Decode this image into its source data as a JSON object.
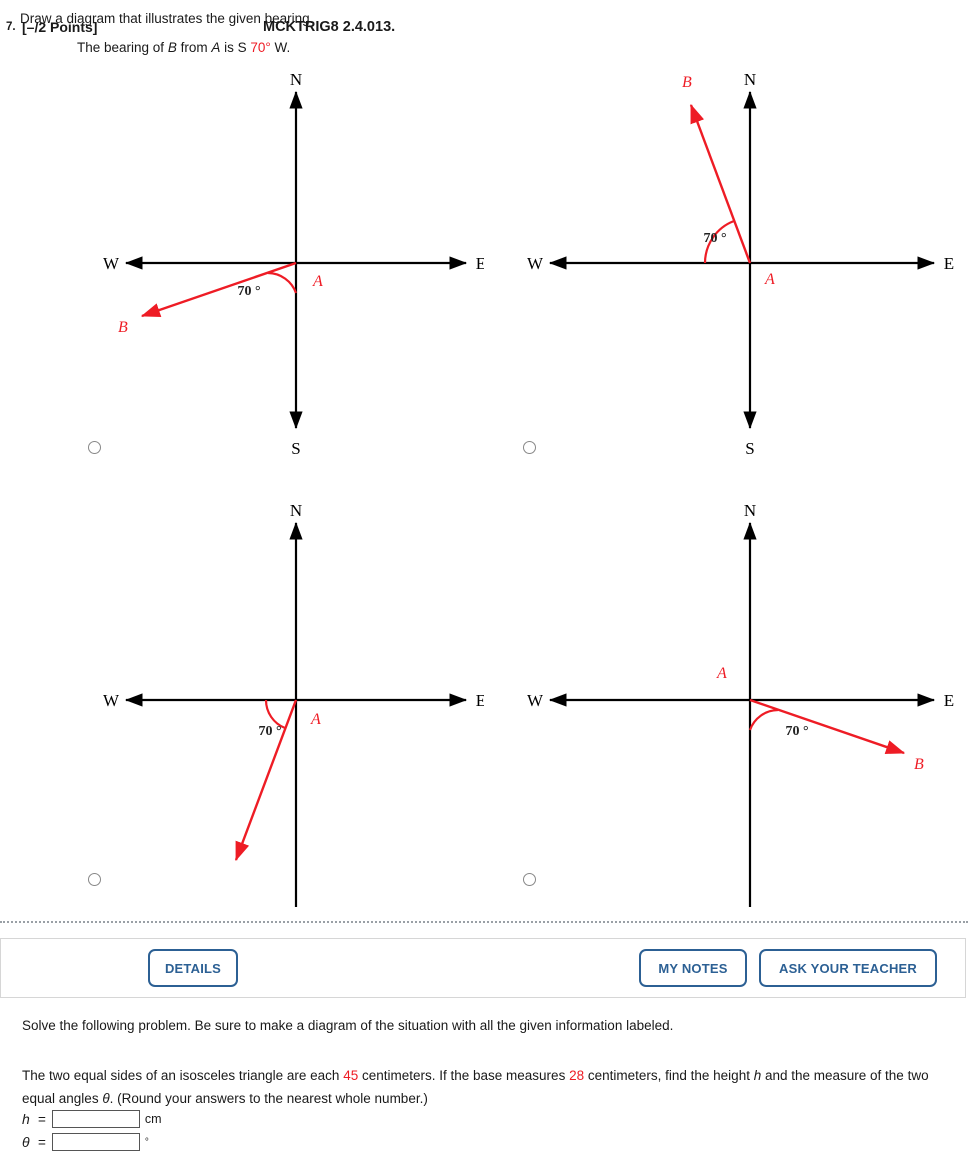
{
  "prompt": {
    "instruction": "Draw a diagram that illustrates the given bearing.",
    "bearing_prefix": "The bearing of ",
    "bearing_b": "B",
    "bearing_mid": " from ",
    "bearing_a": "A",
    "bearing_is": " is S ",
    "bearing_angle": "70°",
    "bearing_suffix": " W."
  },
  "axis_labels": {
    "north": "N",
    "south": "S",
    "east": "E",
    "west": "W"
  },
  "diagrams": [
    {
      "id": "choice-1",
      "point_a": "A",
      "point_b": "B",
      "angle": "70 °",
      "description": "ray from origin into third quadrant, shallow, measured 70 degrees from the south axis toward west"
    },
    {
      "id": "choice-2",
      "point_a": "A",
      "point_b": "B",
      "angle": "70 °",
      "description": "ray from origin into second quadrant, steep, measured 70 degrees from the west axis"
    },
    {
      "id": "choice-3",
      "point_a": "A",
      "point_b": "B",
      "angle": "70 °",
      "description": "ray from origin into third quadrant, steep, measured 70 degrees from the west axis"
    },
    {
      "id": "choice-4",
      "point_a": "A",
      "point_b": "B",
      "angle": "70 °",
      "description": "ray from origin into fourth quadrant, shallow, measured 70 degrees from the east axis"
    }
  ],
  "question": {
    "number": "7.",
    "points": "[–/2 Points]",
    "details_label": "DETAILS",
    "code": "MCKTRIG8 2.4.013.",
    "my_notes_label": "MY NOTES",
    "ask_teacher_label": "ASK YOUR TEACHER",
    "instruction": "Solve the following problem. Be sure to make a diagram of the situation with all the given information labeled.",
    "body_part1": "The two equal sides of an isosceles triangle are each ",
    "body_value1": "45",
    "body_part2": " centimeters. If the base measures ",
    "body_value2": "28",
    "body_part3": " centimeters, find the height ",
    "body_h": "h",
    "body_part4": " and the measure of the two equal angles ",
    "body_theta": "θ",
    "body_part5": ". (Round your answers to the nearest whole number.)",
    "answers": [
      {
        "label": "h",
        "equals": "=",
        "value": "",
        "unit": "cm"
      },
      {
        "label": "θ",
        "equals": "=",
        "value": "",
        "unit": "°"
      }
    ]
  },
  "colors": {
    "accent_red": "#ee1c25",
    "button_blue": "#2c6094",
    "axis_black": "#000000"
  }
}
